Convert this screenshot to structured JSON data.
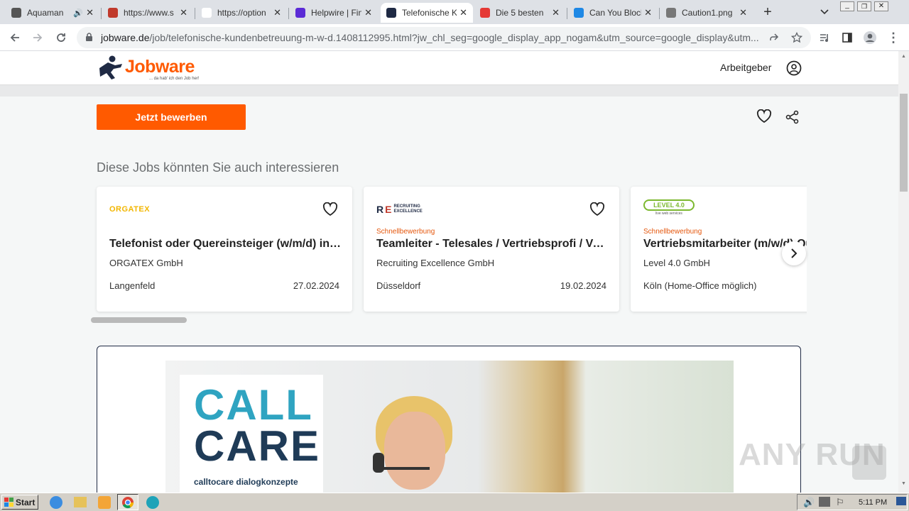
{
  "browser": {
    "tabs": [
      {
        "title": "Aquaman",
        "fav": "#555",
        "active": false
      },
      {
        "title": "https://www.s",
        "fav": "#c0392b",
        "active": false
      },
      {
        "title": "https://option",
        "fav": "#ffffff",
        "active": false
      },
      {
        "title": "Helpwire | Finc",
        "fav": "#5b2bd6",
        "active": false
      },
      {
        "title": "Telefonische K",
        "fav": "#1f2a44",
        "active": true
      },
      {
        "title": "Die 5 besten",
        "fav": "#e53935",
        "active": false
      },
      {
        "title": "Can You Block",
        "fav": "#1e88e5",
        "active": false
      },
      {
        "title": "Caution1.png",
        "fav": "#777",
        "active": false
      }
    ],
    "url_host": "jobware.de",
    "url_path": "/job/telefonische-kundenbetreuung-m-w-d.1408112995.html?jw_chl_seg=google_display_app_nogam&utm_source=google_display&utm..."
  },
  "site": {
    "logo_text": "Jobware",
    "logo_tagline": "... da hab' ich den Job her!",
    "employer_link": "Arbeitgeber",
    "apply_button": "Jetzt bewerben",
    "section_title": "Diese Jobs könnten Sie auch interessieren"
  },
  "jobs": [
    {
      "logo": "ORGATEX",
      "badge": "",
      "title": "Telefonist oder Quereinsteiger (w/m/d) in ...",
      "company": "ORGATEX GmbH",
      "location": "Langenfeld",
      "date": "27.02.2024"
    },
    {
      "logo": "RECRUITING EXCELLENCE",
      "badge": "Schnellbewerbung",
      "title": "Teamleiter - Telesales / Vertriebsprofi / Ve...",
      "company": "Recruiting Excellence GmbH",
      "location": "Düsseldorf",
      "date": "19.02.2024"
    },
    {
      "logo": "LEVEL 4.0",
      "badge": "Schnellbewerbung",
      "title": "Vertriebsmitarbeiter (m/w/d) Qu",
      "company": "Level 4.0 GmbH",
      "location": "Köln (Home-Office möglich)",
      "date": ""
    }
  ],
  "logo_small": {
    "level_sub": "live web services"
  },
  "ad": {
    "brand_line1": "CALL",
    "brand_line2": "CARE",
    "brand_sub": "calltocare dialogkonzepte"
  },
  "watermark": "ANY RUN",
  "taskbar": {
    "start": "Start",
    "clock": "5:11 PM"
  },
  "colors": {
    "brand_orange": "#ff5a00",
    "accent_teal": "#2fa4c1",
    "navy": "#1f3b57"
  }
}
